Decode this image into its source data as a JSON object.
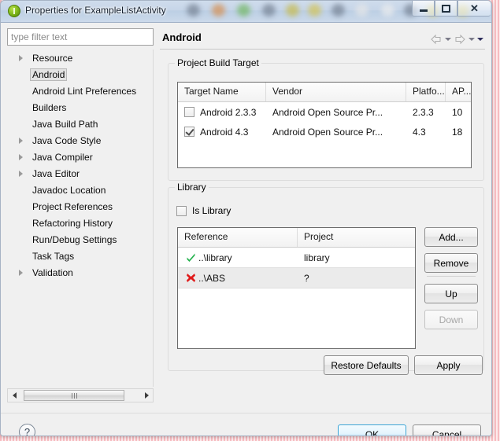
{
  "window": {
    "title": "Properties for ExampleListActivity",
    "icon": "eclipse-green-circle-icon",
    "minimize_label": "–",
    "maximize_label": "",
    "close_label": "✕"
  },
  "sidebar": {
    "filter": {
      "placeholder": "type filter text",
      "value": ""
    },
    "items": [
      {
        "label": "Resource",
        "expandable": true,
        "selected": false
      },
      {
        "label": "Android",
        "expandable": false,
        "selected": true
      },
      {
        "label": "Android Lint Preferences",
        "expandable": false,
        "selected": false
      },
      {
        "label": "Builders",
        "expandable": false,
        "selected": false
      },
      {
        "label": "Java Build Path",
        "expandable": false,
        "selected": false
      },
      {
        "label": "Java Code Style",
        "expandable": true,
        "selected": false
      },
      {
        "label": "Java Compiler",
        "expandable": true,
        "selected": false
      },
      {
        "label": "Java Editor",
        "expandable": true,
        "selected": false
      },
      {
        "label": "Javadoc Location",
        "expandable": false,
        "selected": false
      },
      {
        "label": "Project References",
        "expandable": false,
        "selected": false
      },
      {
        "label": "Refactoring History",
        "expandable": false,
        "selected": false
      },
      {
        "label": "Run/Debug Settings",
        "expandable": false,
        "selected": false
      },
      {
        "label": "Task Tags",
        "expandable": false,
        "selected": false
      },
      {
        "label": "Validation",
        "expandable": true,
        "selected": false
      }
    ]
  },
  "content": {
    "page_title": "Android",
    "nav": {
      "back_icon": "back-arrow-icon",
      "back_menu_icon": "chevron-down-icon",
      "forward_icon": "forward-arrow-icon",
      "forward_menu_icon": "chevron-down-icon",
      "view_menu_icon": "chevron-down-filled-icon"
    },
    "build_target": {
      "group_title": "Project Build Target",
      "columns": [
        "Target Name",
        "Vendor",
        "Platfo...",
        "AP..."
      ],
      "rows": [
        {
          "checked": false,
          "name": "Android 2.3.3",
          "vendor": "Android Open Source Pr...",
          "platform": "2.3.3",
          "api": "10"
        },
        {
          "checked": true,
          "name": "Android 4.3",
          "vendor": "Android Open Source Pr...",
          "platform": "4.3",
          "api": "18"
        }
      ]
    },
    "library": {
      "group_title": "Library",
      "is_library": {
        "label": "Is Library",
        "checked": false
      },
      "columns": [
        "Reference",
        "Project"
      ],
      "rows": [
        {
          "status": "ok",
          "status_icon": "green-check-icon",
          "reference": "..\\library",
          "project": "library",
          "selected": false
        },
        {
          "status": "error",
          "status_icon": "red-x-icon",
          "reference": "..\\ABS",
          "project": "?",
          "selected": true
        }
      ],
      "buttons": [
        {
          "label": "Add...",
          "enabled": true
        },
        {
          "label": "Remove",
          "enabled": true
        },
        {
          "label": "Up",
          "enabled": true
        },
        {
          "label": "Down",
          "enabled": false
        }
      ]
    },
    "page_buttons": [
      {
        "label": "Restore Defaults",
        "enabled": true
      },
      {
        "label": "Apply",
        "enabled": true
      }
    ]
  },
  "footer": {
    "help_icon": "question-mark-icon",
    "help_label": "?",
    "ok_label": "OK",
    "cancel_label": "Cancel"
  },
  "colors": {
    "accent": "#2e9fd4",
    "status_ok": "#22b14c",
    "status_error": "#e01b1b",
    "titlebar": "#c6d5e8",
    "dialog_bg": "#f0f0f0"
  }
}
